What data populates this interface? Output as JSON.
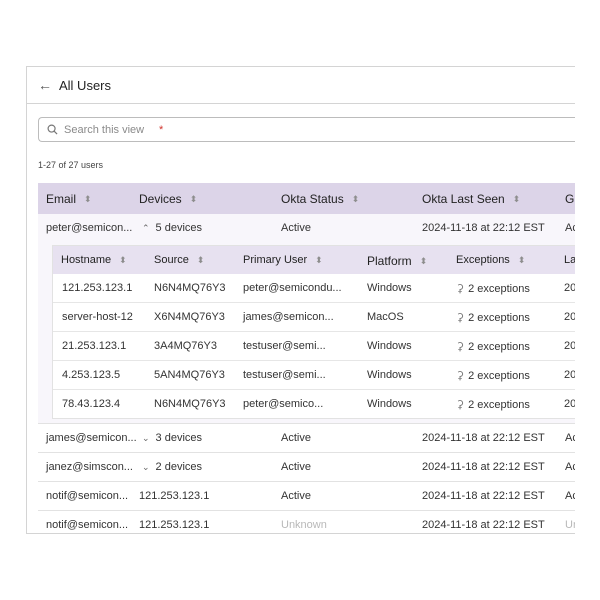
{
  "header": {
    "back_icon": "arrow-left-icon",
    "title": "All Users"
  },
  "search": {
    "placeholder": "Search this view",
    "required_mark": "*"
  },
  "count_label": "1-27 of 27 users",
  "table": {
    "columns": [
      "Email",
      "Devices",
      "Okta Status",
      "Okta Last Seen",
      "G"
    ],
    "rows": [
      {
        "email": "peter@semicon...",
        "devices": "5 devices",
        "status": "Active",
        "last_seen": "2024-11-18 at 22:12 EST",
        "extra": "Ac",
        "expanded": true
      }
    ],
    "subtable": {
      "columns": [
        "Hostname",
        "Source",
        "Primary User",
        "Platform",
        "Exceptions",
        "La"
      ],
      "rows": [
        {
          "hostname": "121.253.123.1",
          "source": "N6N4MQ76Y3",
          "user": "peter@semicondu...",
          "platform": "Windows",
          "exceptions": "2 exceptions",
          "extra": "20"
        },
        {
          "hostname": "server-host-12",
          "source": "X6N4MQ76Y3",
          "user": "james@semicon...",
          "platform": "MacOS",
          "exceptions": "2 exceptions",
          "extra": "20"
        },
        {
          "hostname": "21.253.123.1",
          "source": "3A4MQ76Y3",
          "user": "testuser@semi...",
          "platform": "Windows",
          "exceptions": "2 exceptions",
          "extra": "20"
        },
        {
          "hostname": "4.253.123.5",
          "source": "5AN4MQ76Y3",
          "user": "testuser@semi...",
          "platform": "Windows",
          "exceptions": "2 exceptions",
          "extra": "20"
        },
        {
          "hostname": "78.43.123.4",
          "source": "N6N4MQ76Y3",
          "user": "peter@semico...",
          "platform": "Windows",
          "exceptions": "2 exceptions",
          "extra": "20"
        }
      ]
    },
    "more_rows": [
      {
        "email": "james@semicon...",
        "devices": "3 devices",
        "status": "Active",
        "last_seen": "2024-11-18 at 22:12 EST",
        "extra": "Ac"
      },
      {
        "email": "janez@simscon...",
        "devices": "2 devices",
        "status": "Active",
        "last_seen": "2024-11-18 at 22:12 EST",
        "extra": "Ac"
      },
      {
        "email": "notif@semicon...",
        "devices": "121.253.123.1",
        "status": "Active",
        "last_seen": "2024-11-18 at 22:12 EST",
        "extra": "Ac"
      },
      {
        "email": "notif@semicon...",
        "devices": "121.253.123.1",
        "status": "Unknown",
        "last_seen": "2024-11-18 at 22:12 EST",
        "extra": "Ur"
      }
    ]
  }
}
